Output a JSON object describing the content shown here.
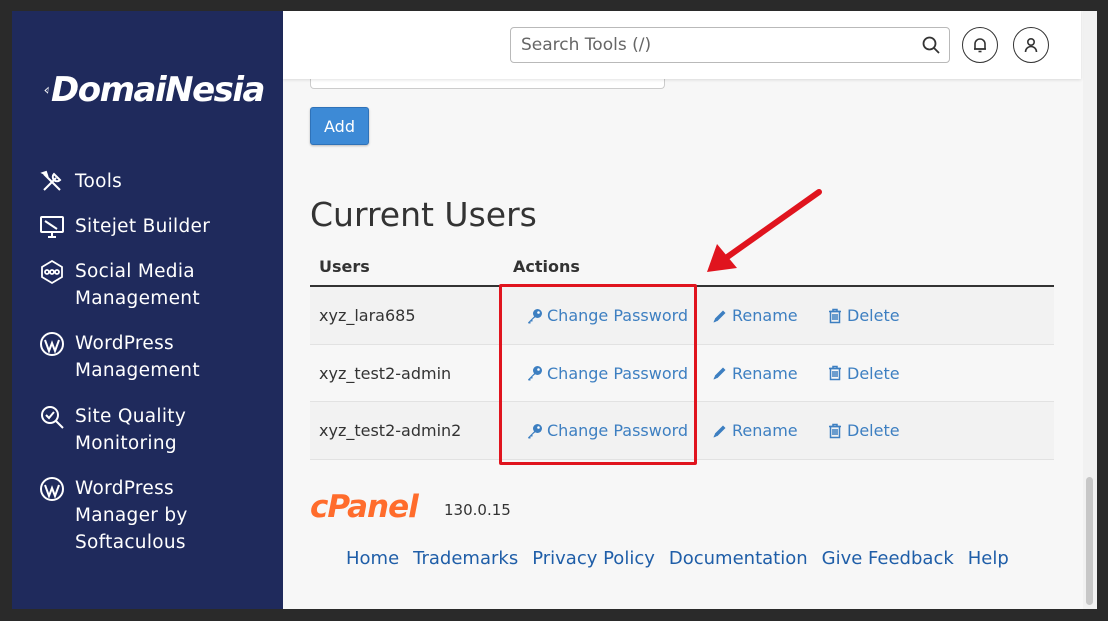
{
  "brand": {
    "name": "DomaiNesia"
  },
  "sidebar": {
    "items": [
      {
        "label": "Tools",
        "icon": "tools-icon"
      },
      {
        "label": "Sitejet Builder",
        "icon": "monitor-icon"
      },
      {
        "label": "Social Media\nManagement",
        "icon": "social-media-icon"
      },
      {
        "label": "WordPress\nManagement",
        "icon": "wordpress-icon"
      },
      {
        "label": "Site Quality\nMonitoring",
        "icon": "magnifier-icon"
      },
      {
        "label": "WordPress\nManager by\nSoftaculous",
        "icon": "wordpress-icon"
      }
    ]
  },
  "topbar": {
    "search_placeholder": "Search Tools (/)",
    "notifications_icon": "bell-icon",
    "user_icon": "user-icon"
  },
  "form": {
    "add_label": "Add"
  },
  "users_section": {
    "title": "Current Users",
    "columns": [
      "Users",
      "Actions"
    ],
    "rows": [
      {
        "user": "xyz_lara685"
      },
      {
        "user": "xyz_test2-admin"
      },
      {
        "user": "xyz_test2-admin2"
      }
    ],
    "actions": {
      "change_password": "Change Password",
      "rename": "Rename",
      "delete": "Delete"
    }
  },
  "footer": {
    "cpanel_version": "130.0.15",
    "links": [
      "Home",
      "Trademarks",
      "Privacy Policy",
      "Documentation",
      "Give Feedback",
      "Help"
    ]
  },
  "colors": {
    "sidebar_bg": "#1f2a5c",
    "link": "#3d7fc1",
    "button": "#3d8ad6",
    "annotation": "#e0141e",
    "cpanel_orange": "#ff6c2c"
  }
}
